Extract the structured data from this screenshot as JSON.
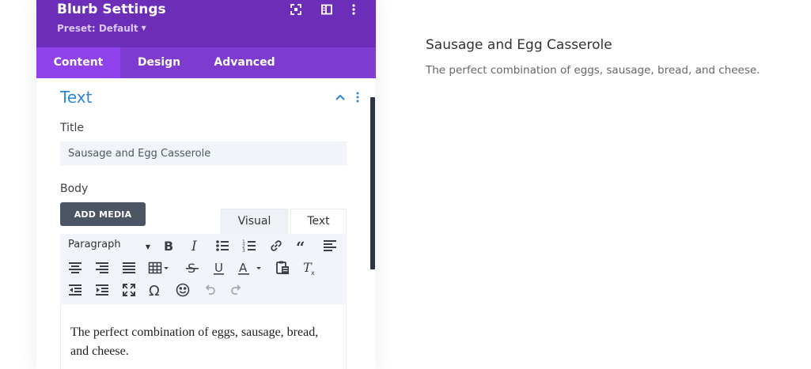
{
  "modal": {
    "title": "Blurb Settings",
    "preset": "Preset: Default",
    "header_icons": [
      "expand-icon",
      "sidebar-layout-icon",
      "more-vertical-icon"
    ]
  },
  "tabs": [
    {
      "label": "Content",
      "active": true
    },
    {
      "label": "Design",
      "active": false
    },
    {
      "label": "Advanced",
      "active": false
    }
  ],
  "section": {
    "title": "Text",
    "expanded": true
  },
  "fields": {
    "title_label": "Title",
    "title_value": "Sausage and Egg Casserole",
    "body_label": "Body",
    "add_media_label": "ADD MEDIA"
  },
  "editor": {
    "visual_tab": "Visual",
    "text_tab": "Text",
    "format_value": "Paragraph",
    "content": "The perfect combination of eggs, sausage, bread, and cheese."
  },
  "preview": {
    "title": "Sausage and Egg Casserole",
    "body": "The perfect combination of eggs, sausage, bread, and cheese."
  },
  "colors": {
    "header": "#6c2eb9",
    "tabs": "#7e3bd0",
    "active_tab": "#8f42ec",
    "section_title": "#2b87da",
    "add_media": "#4b5563"
  }
}
